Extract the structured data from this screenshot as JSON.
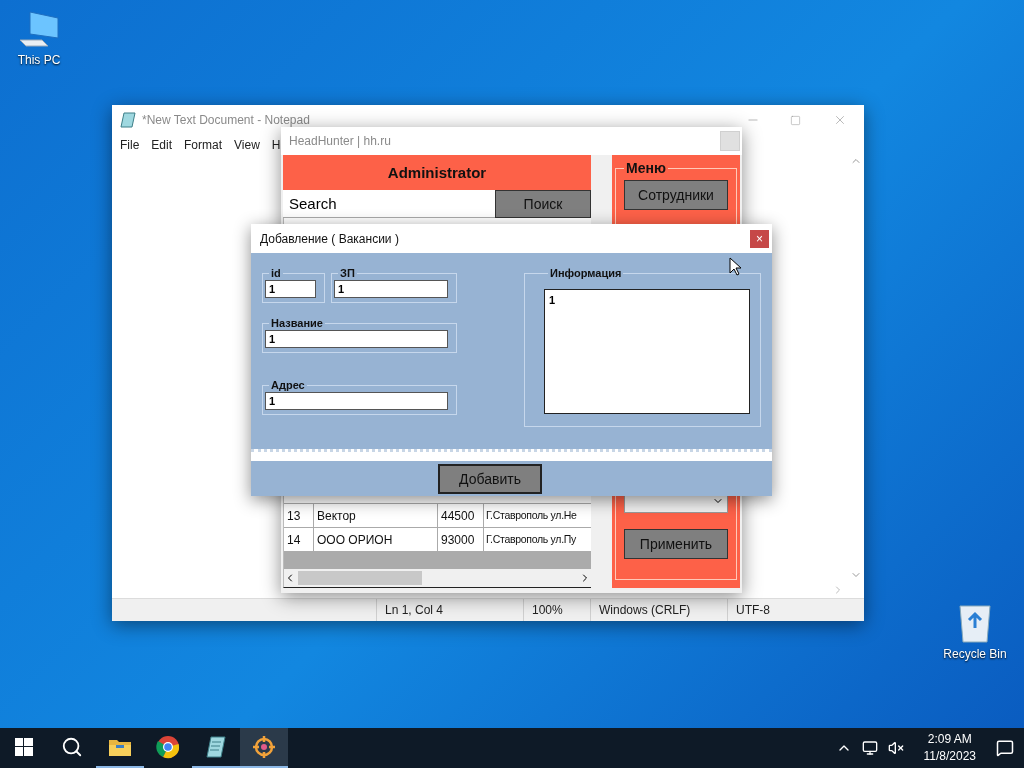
{
  "desktop": {
    "icons": [
      {
        "kind": "computer",
        "label": "This PC"
      },
      {
        "kind": "bin",
        "label": "Recycle Bin"
      }
    ]
  },
  "notepad": {
    "title": "*New Text Document - Notepad",
    "menu": [
      "File",
      "Edit",
      "Format",
      "View",
      "H"
    ],
    "status_bar": [
      "Ln 1, Col 4",
      "100%",
      "Windows (CRLF)",
      "UTF-8"
    ]
  },
  "app": {
    "title": "HeadHunter | hh.ru",
    "header": "Administrator",
    "search": {
      "value": "Search"
    },
    "search_button": "Поиск",
    "table": {
      "rows": [
        [
          "13",
          "Вектор",
          "44500",
          "Г.Ставрополь ул.Не"
        ],
        [
          "14",
          "ООО ОРИОН",
          "93000",
          "Г.Ставрополь ул.Пу"
        ]
      ]
    },
    "menu": {
      "title": "Меню",
      "buttons": [
        "Сотрудники"
      ],
      "apply_button": "Применить"
    }
  },
  "dialog": {
    "title": "Добавление ( Вакансии )",
    "close": "×",
    "fields": [
      {
        "label": "id",
        "value": "1"
      },
      {
        "label": "ЗП",
        "value": "1"
      },
      {
        "label": "Название",
        "value": "1"
      },
      {
        "label": "Адрес",
        "value": "1"
      }
    ],
    "info": {
      "label": "Информация",
      "value": "1"
    },
    "submit": "Добавить"
  },
  "taskbar": {
    "apps": [
      {
        "kind": "folder",
        "running": true,
        "selected": false
      },
      {
        "kind": "browser",
        "running": false,
        "selected": false
      },
      {
        "kind": "notepad",
        "running": true,
        "selected": false
      },
      {
        "kind": "target",
        "running": true,
        "selected": true
      }
    ],
    "clock": {
      "time": "2:09 AM",
      "date": "11/8/2023"
    }
  }
}
